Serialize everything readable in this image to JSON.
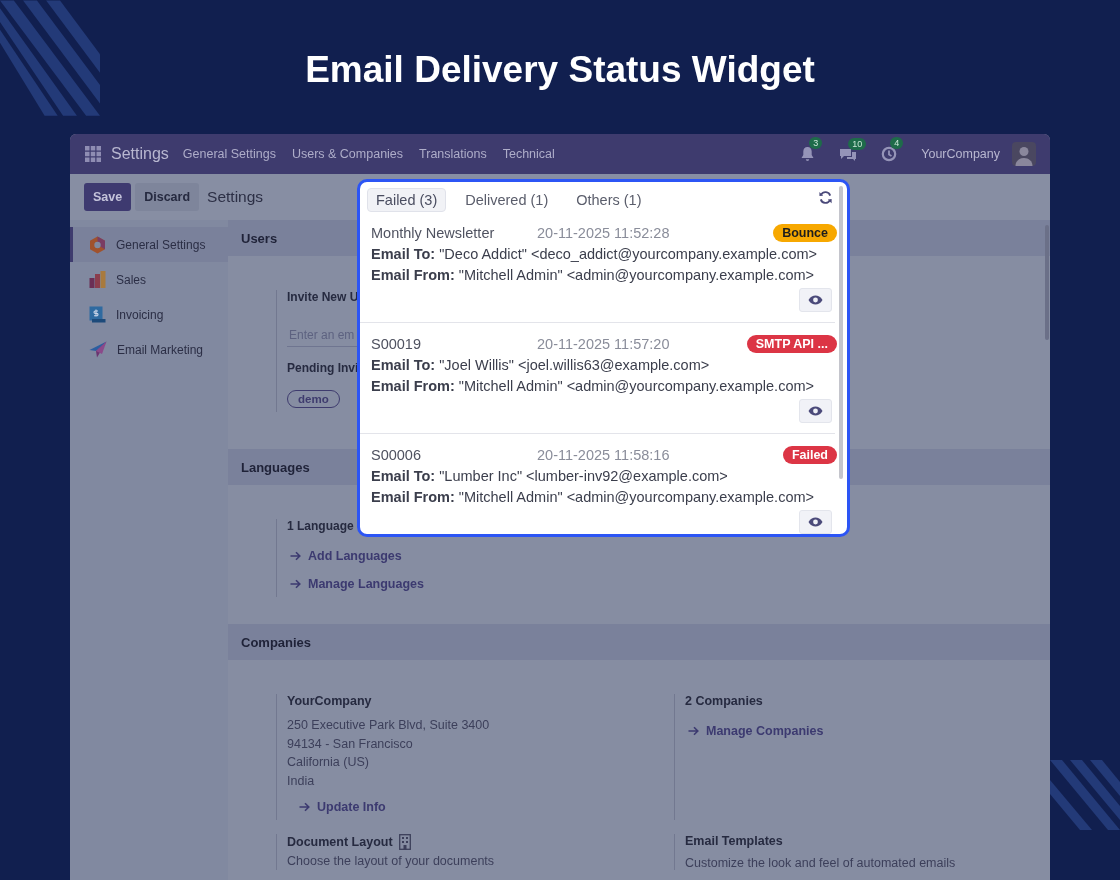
{
  "title": "Email Delivery Status Widget",
  "navbar": {
    "app": "Settings",
    "menu": [
      "General Settings",
      "Users & Companies",
      "Translations",
      "Technical"
    ],
    "notifications": [
      {
        "kind": "bell",
        "count": "3"
      },
      {
        "kind": "chat",
        "count": "10"
      },
      {
        "kind": "clock",
        "count": "4"
      }
    ],
    "company": "YourCompany"
  },
  "control_bar": {
    "buttons": [
      {
        "label": "Save",
        "kind": "primary"
      },
      {
        "label": "Discard",
        "kind": "secondary"
      }
    ],
    "breadcrumb": "Settings"
  },
  "sidebar": {
    "items": [
      {
        "label": "General Settings",
        "kind": "general",
        "selected": true
      },
      {
        "label": "Sales",
        "kind": "sales",
        "selected": false
      },
      {
        "label": "Invoicing",
        "kind": "invoicing",
        "selected": false
      },
      {
        "label": "Email Marketing",
        "kind": "email",
        "selected": false
      }
    ]
  },
  "users": {
    "title": "Users",
    "invite_label": "Invite New U",
    "email_placeholder": "Enter an em",
    "pending_label": "Pending Invi",
    "pending_tags": [
      "demo"
    ]
  },
  "languages": {
    "title": "Languages",
    "count": "1 Language",
    "links": [
      "Add Languages",
      "Manage Languages"
    ]
  },
  "companies": {
    "title": "Companies",
    "company": {
      "name": "YourCompany",
      "address": [
        "250 Executive Park Blvd, Suite 3400",
        "94134 - San Francisco",
        "California (US)",
        "India"
      ],
      "link": "Update Info"
    },
    "summary": {
      "count": "2 Companies",
      "link": "Manage Companies"
    },
    "document_layout": {
      "title": "Document Layout",
      "description": "Choose the layout of your documents"
    },
    "email_templates": {
      "title": "Email Templates",
      "description": "Customize the look and feel of automated emails"
    }
  },
  "popup": {
    "tabs": [
      {
        "label": "Failed (3)",
        "selected": true
      },
      {
        "label": "Delivered (1)",
        "selected": false
      },
      {
        "label": "Others (1)",
        "selected": false
      }
    ],
    "items": [
      {
        "subject": "Monthly Newsletter",
        "date": "20-11-2025 11:52:28",
        "status": "Bounce",
        "color": "#f7a800",
        "to": "**Email To:** \"Deco Addict\" <deco_addict@yourcompany.example.com>",
        "from": "**Email From:** \"Mitchell Admin\" <admin@yourcompany.example.com>"
      },
      {
        "subject": "S00019",
        "date": "20-11-2025 11:57:20",
        "status": "SMTP API ...",
        "color": "#dc3545",
        "to": "**Email To:** \"Joel Willis\" <joel.willis63@example.com>",
        "from": "**Email From:** \"Mitchell Admin\" <admin@yourcompany.example.com>"
      },
      {
        "subject": "S00006",
        "date": "20-11-2025 11:58:16",
        "status": "Failed",
        "color": "#dc3545",
        "to": "**Email To:** \"Lumber Inc\" <lumber-inv92@example.com>",
        "from": "**Email From:** \"Mitchell Admin\" <admin@yourcompany.example.com>"
      }
    ]
  }
}
